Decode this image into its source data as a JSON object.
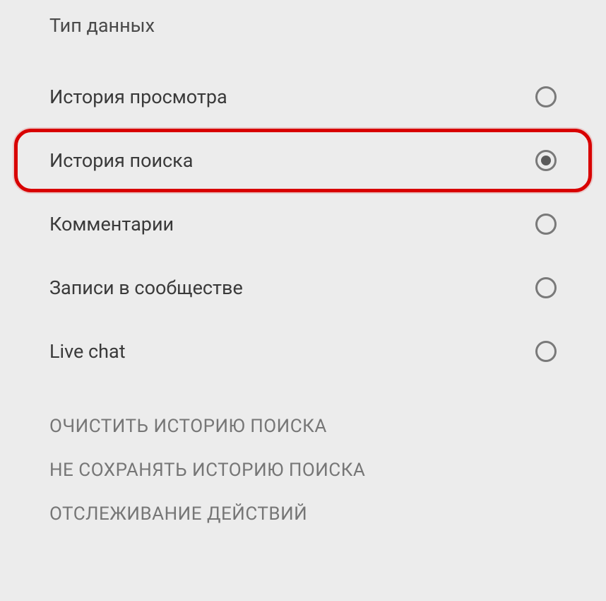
{
  "section_title": "Тип данных",
  "radio_options": [
    {
      "label": "История просмотра",
      "selected": false,
      "highlighted": false
    },
    {
      "label": "История поиска",
      "selected": true,
      "highlighted": true
    },
    {
      "label": "Комментарии",
      "selected": false,
      "highlighted": false
    },
    {
      "label": "Записи в сообществе",
      "selected": false,
      "highlighted": false
    },
    {
      "label": "Live chat",
      "selected": false,
      "highlighted": false
    }
  ],
  "actions": [
    {
      "label": "ОЧИСТИТЬ ИСТОРИЮ ПОИСКА"
    },
    {
      "label": "НЕ СОХРАНЯТЬ ИСТОРИЮ ПОИСКА"
    },
    {
      "label": "ОТСЛЕЖИВАНИЕ ДЕЙСТВИЙ"
    }
  ]
}
